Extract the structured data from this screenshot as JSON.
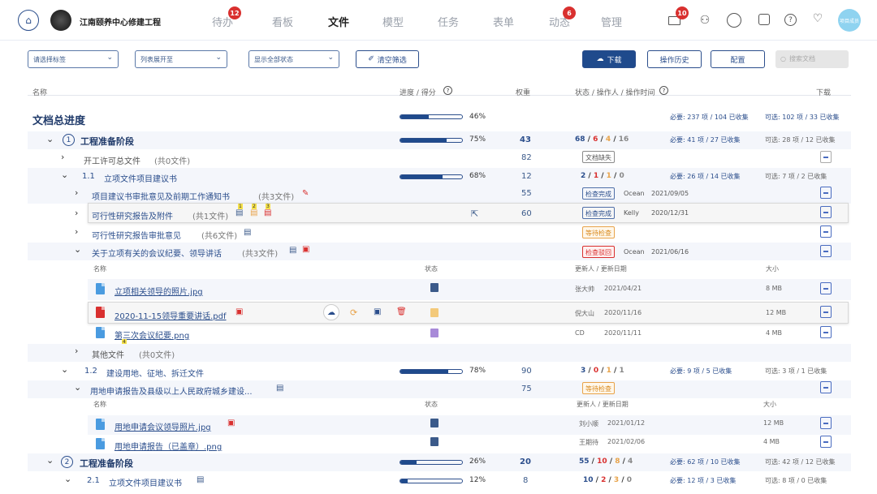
{
  "header": {
    "project": "江南颐养中心修建工程",
    "nav": [
      {
        "label": "待办",
        "badge": "12"
      },
      {
        "label": "看板"
      },
      {
        "label": "文件",
        "active": true
      },
      {
        "label": "模型"
      },
      {
        "label": "任务"
      },
      {
        "label": "表单"
      },
      {
        "label": "动态",
        "badge": "6"
      },
      {
        "label": "管理"
      }
    ],
    "mail_badge": "10",
    "avatar_text": "项目成员"
  },
  "toolbar": {
    "filter_tag": "请选择标签",
    "list_expand": "列表展开至",
    "show_status": "显示全部状态",
    "clear_filter": "清空筛选",
    "download": "下载",
    "history": "操作历史",
    "config": "配置",
    "search_placeholder": "搜索文档"
  },
  "columns": {
    "name": "名称",
    "progress": "进度 / 得分",
    "weight": "权重",
    "status": "状态 / 操作人 / 操作时间",
    "download": "下载"
  },
  "summary": {
    "title": "文档总进度",
    "pct": "46%",
    "required": "必要: 237 项 / 104 已收集",
    "optional": "可选: 102 项 / 33 已收集"
  },
  "rows": {
    "s1": {
      "num": "1",
      "name": "工程准备阶段",
      "pct": "75%",
      "weight": "43",
      "c1": "68",
      "c2": "6",
      "c3": "4",
      "c4": "16",
      "required": "必要: 41 项 / 27 已收集",
      "optional": "可选: 28 项 / 12 已收集"
    },
    "r_kg": {
      "name": "开工许可总文件",
      "count": "(共0文件)",
      "weight": "82",
      "tag": "文档缺失"
    },
    "r_11": {
      "num": "1.1",
      "name": "立项文件项目建议书",
      "pct": "68%",
      "weight": "12",
      "c1": "2",
      "c2": "1",
      "c3": "1",
      "c4": "0",
      "required": "必要: 26 项 / 14 已收集",
      "optional": "可选: 7 项 / 2 已收集"
    },
    "r_jy": {
      "name": "项目建议书审批意见及前期工作通知书",
      "count": "(共3文件)",
      "weight": "55",
      "tag": "检查完成",
      "user": "Ocean",
      "date": "2021/09/05"
    },
    "r_kx": {
      "name": "可行性研究报告及附件",
      "count": "(共1文件)",
      "weight": "60",
      "tag": "检查完成",
      "user": "Kelly",
      "date": "2020/12/31"
    },
    "r_kxsp": {
      "name": "可行性研究报告审批意见",
      "count": "(共6文件)",
      "tag": "等待检查"
    },
    "r_hy": {
      "name": "关于立项有关的会议纪要、领导讲话",
      "count": "(共3文件)",
      "tag": "检查驳回",
      "user": "Ocean",
      "date": "2021/06/16"
    },
    "sub1": {
      "name": "名称",
      "status": "状态",
      "updater": "更新人 / 更新日期",
      "size": "大小"
    },
    "f1": {
      "name": "立项相关领导的照片.jpg",
      "user": "张大帅",
      "date": "2021/04/21",
      "size": "8 MB"
    },
    "f2": {
      "name": "2020-11-15领导重要讲话.pdf",
      "user": "倪大山",
      "date": "2020/11/16",
      "size": "12 MB"
    },
    "f3": {
      "name": "第三次会议纪要.png",
      "user": "CD",
      "date": "2020/11/11",
      "size": "4 MB",
      "mark": "4"
    },
    "r_qt": {
      "name": "其他文件",
      "count": "(共0文件)"
    },
    "r_12": {
      "num": "1.2",
      "name": "建设用地、征地、拆迁文件",
      "pct": "78%",
      "weight": "90",
      "c1": "3",
      "c2": "0",
      "c3": "1",
      "c4": "1",
      "required": "必要: 9 项 / 5 已收集",
      "optional": "可选: 3 项 / 1 已收集"
    },
    "r_yd": {
      "name": "用地申请报告及县级以上人民政府城乡建设...",
      "weight": "75",
      "tag": "等待检查"
    },
    "sub2": {
      "name": "名称",
      "status": "状态",
      "updater": "更新人 / 更新日期",
      "size": "大小"
    },
    "f4": {
      "name": "用地申请会议领导照片.jpg",
      "user": "刘小顺",
      "date": "2021/01/12",
      "size": "12 MB"
    },
    "f5": {
      "name": "用地申请报告（已盖章）.png",
      "user": "王期待",
      "date": "2021/02/06",
      "size": "4 MB"
    },
    "s2": {
      "num": "2",
      "name": "工程准备阶段",
      "pct": "26%",
      "weight": "20",
      "c1": "55",
      "c2": "10",
      "c3": "8",
      "c4": "4",
      "required": "必要: 62 项 / 10 已收集",
      "optional": "可选: 42 项 / 12 已收集"
    },
    "r_21": {
      "num": "2.1",
      "name": "立项文件项目建议书",
      "pct": "12%",
      "weight": "8",
      "c1": "10",
      "c2": "2",
      "c3": "3",
      "c4": "0",
      "required": "必要: 12 项 / 3 已收集",
      "optional": "可选: 8 项 / 0 已收集"
    }
  },
  "progress": {
    "summary": 0.46,
    "s1": 0.75,
    "r_11": 0.68,
    "r_12": 0.78,
    "s2": 0.26,
    "r_21": 0.12
  },
  "colors": {
    "primary": "#1f4a8c",
    "red": "#d9302f",
    "orange": "#e8a34a",
    "file_blue": "#4a9be0"
  }
}
